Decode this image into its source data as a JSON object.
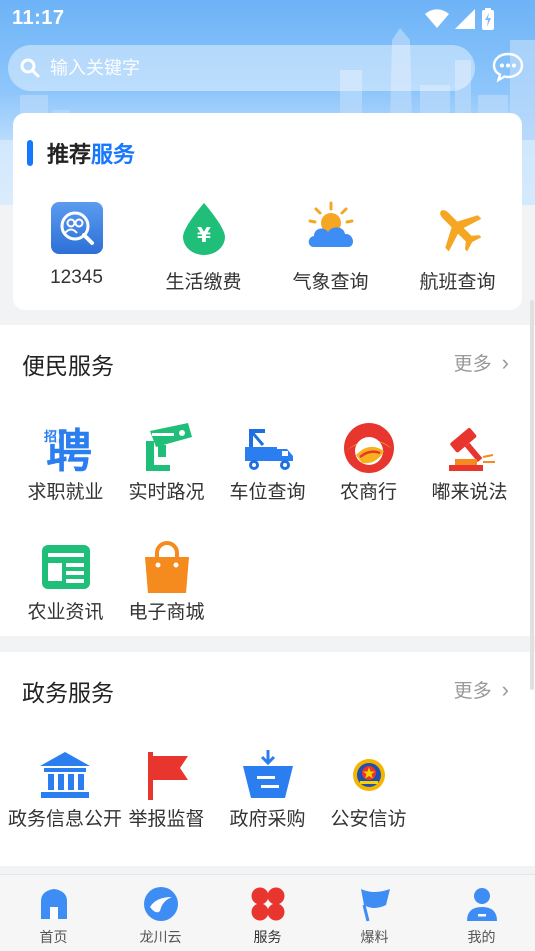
{
  "status": {
    "time": "11:17"
  },
  "search": {
    "placeholder": "输入关键字"
  },
  "recommended": {
    "title_prefix": "推荐",
    "title_accent": "服务",
    "items": [
      {
        "label": "12345",
        "icon": "hotline-icon"
      },
      {
        "label": "生活缴费",
        "icon": "payment-drop-icon"
      },
      {
        "label": "气象查询",
        "icon": "weather-icon"
      },
      {
        "label": "航班查询",
        "icon": "airplane-icon"
      }
    ]
  },
  "convenience": {
    "title": "便民服务",
    "more": "更多",
    "items": [
      {
        "label": "求职就业",
        "icon": "recruit-icon"
      },
      {
        "label": "实时路况",
        "icon": "traffic-camera-icon"
      },
      {
        "label": "车位查询",
        "icon": "parking-truck-icon"
      },
      {
        "label": "农商行",
        "icon": "bank-logo-icon"
      },
      {
        "label": "嘟来说法",
        "icon": "gavel-icon"
      },
      {
        "label": "农业资讯",
        "icon": "news-icon"
      },
      {
        "label": "电子商城",
        "icon": "shopping-bag-icon"
      }
    ],
    "recruit_char": "聘",
    "recruit_small": "招"
  },
  "government": {
    "title": "政务服务",
    "more": "更多",
    "items": [
      {
        "label": "政务信息公开",
        "icon": "government-building-icon"
      },
      {
        "label": "举报监督",
        "icon": "red-flag-icon"
      },
      {
        "label": "政府采购",
        "icon": "purchase-basket-icon"
      },
      {
        "label": "公安信访",
        "icon": "police-emblem-icon"
      }
    ]
  },
  "tabs": [
    {
      "label": "首页",
      "icon": "home-icon"
    },
    {
      "label": "龙川云",
      "icon": "cloud-logo-icon"
    },
    {
      "label": "服务",
      "icon": "services-clover-icon"
    },
    {
      "label": "爆料",
      "icon": "flag-icon"
    },
    {
      "label": "我的",
      "icon": "profile-icon"
    }
  ],
  "colors": {
    "accent": "#1677ff",
    "red": "#e8362f",
    "green": "#1fbf7a",
    "orange": "#f58a1f"
  }
}
